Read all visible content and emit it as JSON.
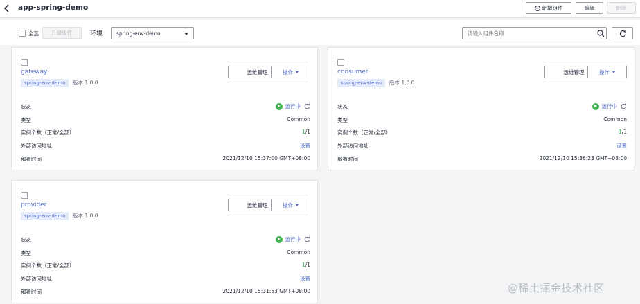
{
  "header": {
    "title": "app-spring-demo",
    "add_label": "新增组件",
    "edit_label": "编辑",
    "delete_label": "删除"
  },
  "filter": {
    "select_all_label": "全选",
    "upgrade_label": "升级组件",
    "env_label": "环境",
    "env_value": "spring-env-demo",
    "search_placeholder": "请输入组件名称"
  },
  "card_labels": {
    "ops_button": "运维管理",
    "action_button": "操作",
    "status_label": "状态",
    "type_label": "类型",
    "instances_label": "实例个数（正常/全部）",
    "external_label": "外部访问地址",
    "deploy_time_label": "部署时间"
  },
  "components": [
    {
      "name": "gateway",
      "env_tag": "spring-env-demo",
      "version": "版本 1.0.0",
      "status": "运行中",
      "type": "Common",
      "instances_running": "1",
      "instances_total": "/1",
      "external": "设置",
      "deploy_time": "2021/12/10 15:37:00 GMT+08:00"
    },
    {
      "name": "consumer",
      "env_tag": "spring-env-demo",
      "version": "版本 1.0.0",
      "status": "运行中",
      "type": "Common",
      "instances_running": "1",
      "instances_total": "/1",
      "external": "设置",
      "deploy_time": "2021/12/10 15:36:23 GMT+08:00"
    },
    {
      "name": "provider",
      "env_tag": "spring-env-demo",
      "version": "版本 1.0.0",
      "status": "运行中",
      "type": "Common",
      "instances_running": "1",
      "instances_total": "/1",
      "external": "设置",
      "deploy_time": "2021/12/10 15:31:53 GMT+08:00"
    }
  ],
  "watermark": "@稀土掘金技术社区",
  "colors": {
    "link": "#526ecc",
    "running": "#3fb34f",
    "tag_bg": "#e4ecfb"
  }
}
